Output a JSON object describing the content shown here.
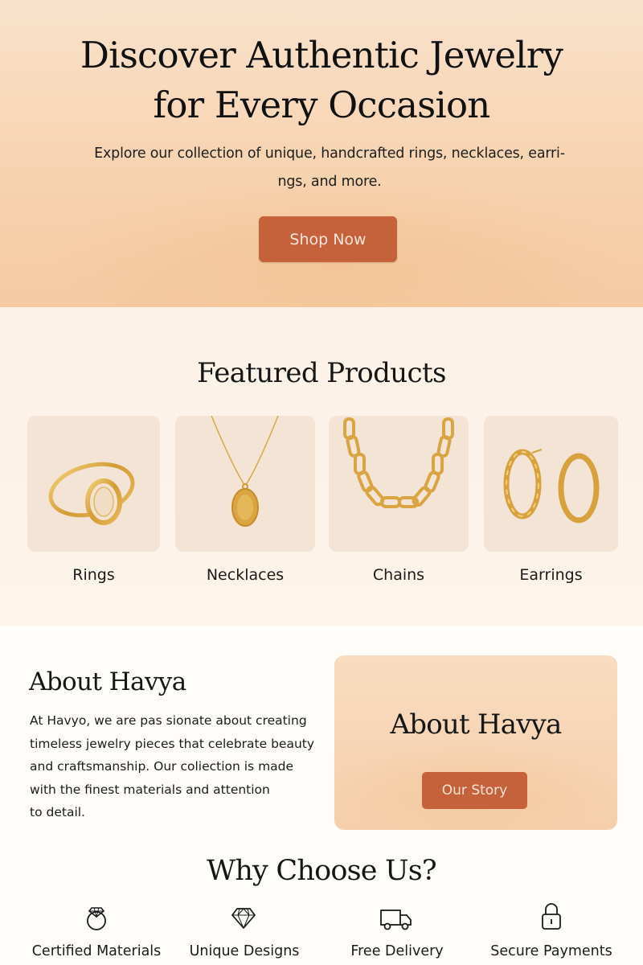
{
  "hero": {
    "title_line1": "Discover Authentic Jewelry",
    "title_line2": "for Every Occasion",
    "subtitle_line1": "Explore our collection of unique, handcrafted rings, necklaces, earri-",
    "subtitle_line2": "ngs, and more.",
    "cta_label": "Shop Now"
  },
  "featured": {
    "title": "Featured Products",
    "products": [
      {
        "label": "Rings",
        "icon": "ring-image"
      },
      {
        "label": "Necklaces",
        "icon": "necklace-image"
      },
      {
        "label": "Chains",
        "icon": "chain-image"
      },
      {
        "label": "Earrings",
        "icon": "earrings-image"
      }
    ]
  },
  "about": {
    "heading": "About Havya",
    "lines": [
      "At Havyo, we are pas sionate about creating",
      "timeless jewelry pieces that celebrate beauty",
      "and craftsmanship. Our coliection is made",
      "with the finest materials and attention",
      "to detail."
    ],
    "card_title": "About Havya",
    "card_button": "Our Story"
  },
  "why": {
    "title": "Why Choose Us?",
    "features": [
      {
        "label": "Certified Materials",
        "icon": "ring-icon"
      },
      {
        "label": "Unique Designs",
        "icon": "diamond-icon"
      },
      {
        "label": "Free Delivery",
        "icon": "truck-icon"
      },
      {
        "label": "Secure Payments",
        "icon": "lock-icon"
      }
    ]
  },
  "colors": {
    "accent": "#c5623b",
    "hero_background": "#f7d3b0",
    "product_tile": "#f3e4d6",
    "gold": "#d9a441"
  }
}
